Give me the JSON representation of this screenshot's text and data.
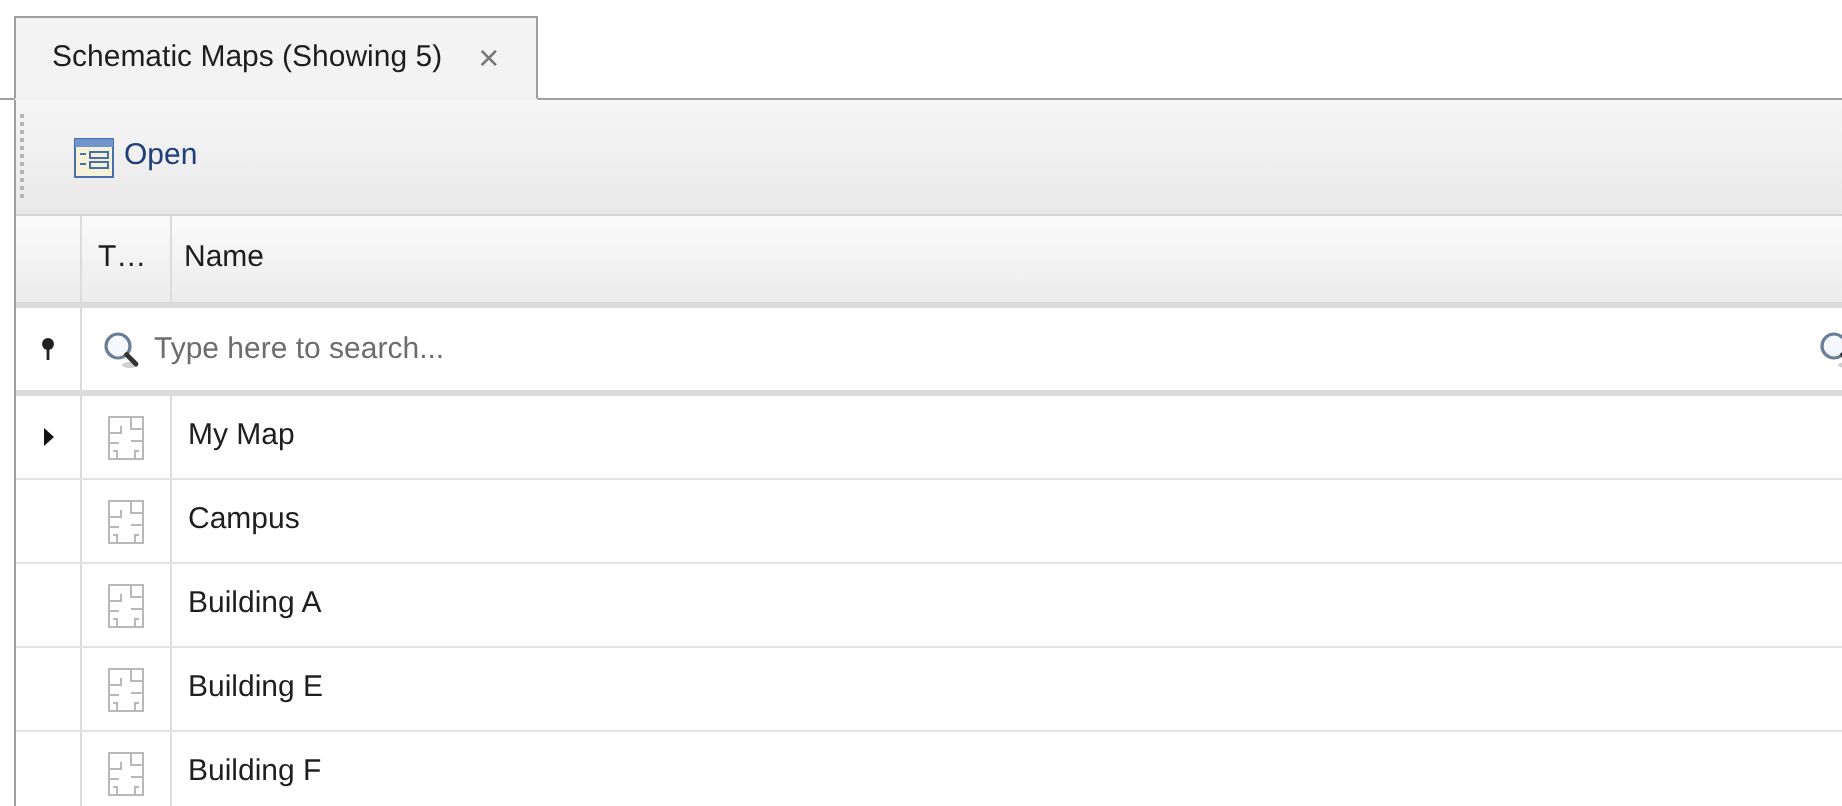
{
  "tabs": [
    {
      "label": "Schematic Maps (Showing 5)",
      "selected": true,
      "close": "×"
    }
  ],
  "toolbar": {
    "buttons": [
      {
        "label": "Open"
      }
    ]
  },
  "table": {
    "columns": [
      "T…",
      "Name"
    ],
    "filter": {
      "placeholder": "Type here to search..."
    },
    "rows": [
      {
        "name": "My Map",
        "selected": true
      },
      {
        "name": "Campus",
        "selected": false
      },
      {
        "name": "Building A",
        "selected": false
      },
      {
        "name": "Building E",
        "selected": false
      },
      {
        "name": "Building F",
        "selected": false
      }
    ]
  }
}
